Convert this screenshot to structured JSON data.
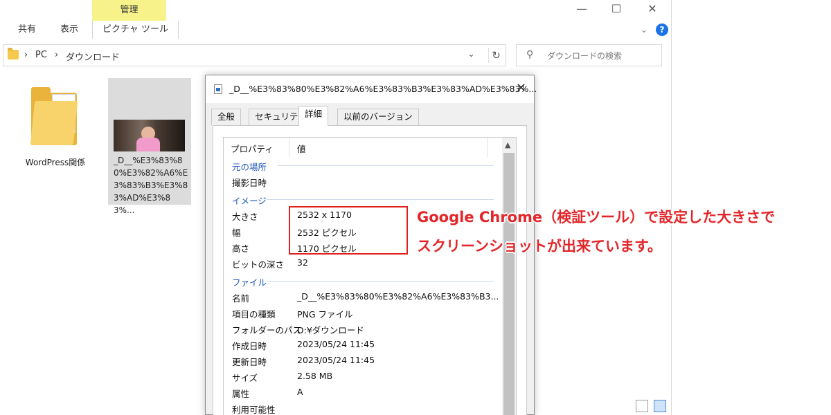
{
  "ribbon": {
    "context_header": "管理",
    "tabs": [
      {
        "label": "共有"
      },
      {
        "label": "表示"
      },
      {
        "label": "ピクチャ ツール"
      }
    ]
  },
  "window_controls": {
    "minimize": "—",
    "maximize": "☐",
    "close": "✕"
  },
  "help_label": "?",
  "address": {
    "crumbs": [
      "›",
      "PC",
      "›",
      "ダウンロード"
    ],
    "dropdown_glyph": "⌄",
    "refresh_glyph": "↻"
  },
  "search": {
    "placeholder": "ダウンロードの検索"
  },
  "files": [
    {
      "label": "WordPress関係"
    },
    {
      "label": "_D__%E3%83%80%E3%82%A6%E3%83%B3%E3%83%AD%E3%83%..."
    }
  ],
  "dialog": {
    "title": "_D__%E3%83%80%E3%82%A6%E3%83%B3%E3%83%AD%E3%83%...",
    "close_glyph": "✕",
    "tabs": [
      "全般",
      "セキュリティ",
      "詳細",
      "以前のバージョン"
    ],
    "columns": {
      "property": "プロパティ",
      "value": "値"
    },
    "sections": {
      "origin": "元の場所",
      "image": "イメージ",
      "file": "ファイル"
    },
    "origin_rows": [
      {
        "name": "撮影日時",
        "value": ""
      }
    ],
    "image_rows": [
      {
        "name": "大きさ",
        "value": "2532 x 1170"
      },
      {
        "name": "幅",
        "value": "2532 ピクセル"
      },
      {
        "name": "高さ",
        "value": "1170 ピクセル"
      },
      {
        "name": "ビットの深さ",
        "value": "32"
      }
    ],
    "file_rows": [
      {
        "name": "名前",
        "value": "_D__%E3%83%80%E3%82%A6%E3%83%B3..."
      },
      {
        "name": "項目の種類",
        "value": "PNG ファイル"
      },
      {
        "name": "フォルダーのパス",
        "value": "D:¥ダウンロード"
      },
      {
        "name": "作成日時",
        "value": "2023/05/24 11:45"
      },
      {
        "name": "更新日時",
        "value": "2023/05/24 11:45"
      },
      {
        "name": "サイズ",
        "value": "2.58 MB"
      },
      {
        "name": "属性",
        "value": "A"
      },
      {
        "name": "利用可能性",
        "value": ""
      }
    ]
  },
  "annotation": {
    "line1": "Google Chrome（検証ツール）で設定した大きさで",
    "line2": "スクリーンショットが出来ています。",
    "color": "#e3262a"
  }
}
